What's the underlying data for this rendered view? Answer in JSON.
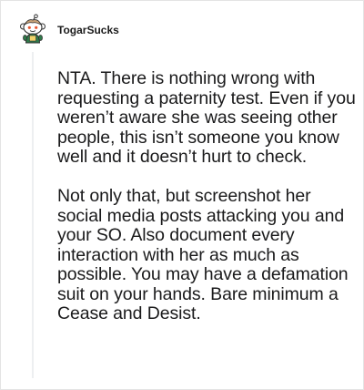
{
  "comment": {
    "author": "TogarSucks",
    "avatar_icon": "snoo-avatar-icon",
    "paragraphs": [
      "NTA. There is nothing wrong with requesting a paternity test. Even if you weren’t aware she was seeing other people, this isn’t someone you know well and it doesn’t hurt to check.",
      "Not only that, but screenshot her social media posts attacking you and your SO. Also document every interaction with her as much as possible. You may have a defamation suit on your hands. Bare minimum a Cease and Desist."
    ]
  },
  "colors": {
    "text": "#1a1a1b",
    "thread_line": "#edeff1",
    "border": "#e4e4e4"
  }
}
